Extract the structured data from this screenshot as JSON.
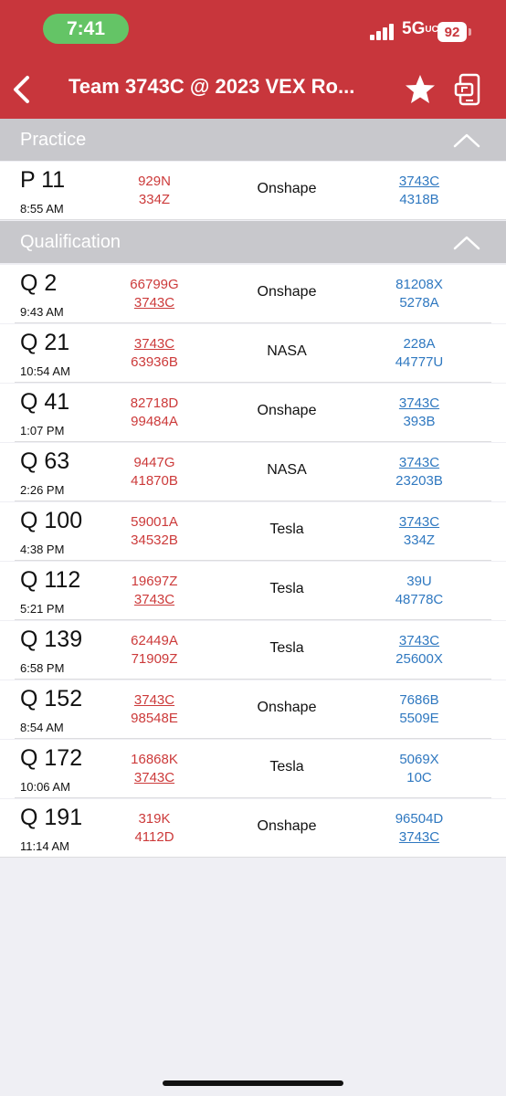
{
  "status": {
    "time": "7:41",
    "network": "5G",
    "network_suffix": "UC",
    "battery": "92"
  },
  "nav": {
    "title": "Team 3743C @ 2023 VEX Ro...",
    "icons": [
      "back-chevron-icon",
      "star-icon",
      "device-share-icon"
    ]
  },
  "colors": {
    "header_red": "#c8363c",
    "alliance_red": "#cc3a3a",
    "alliance_blue": "#2f78c0",
    "section_gray": "#c8c8cc",
    "time_pill_green": "#64c466"
  },
  "sections": [
    {
      "label": "Practice"
    },
    {
      "label": "Qualification"
    }
  ],
  "practice": [
    {
      "match": "P 11",
      "time": "8:55 AM",
      "red": [
        "929N",
        "334Z"
      ],
      "field": "Onshape",
      "blue": [
        "3743C",
        "4318B"
      ]
    }
  ],
  "qualification": [
    {
      "match": "Q 2",
      "time": "9:43 AM",
      "red": [
        "66799G",
        "3743C"
      ],
      "field": "Onshape",
      "blue": [
        "81208X",
        "5278A"
      ]
    },
    {
      "match": "Q 21",
      "time": "10:54 AM",
      "red": [
        "3743C",
        "63936B"
      ],
      "field": "NASA",
      "blue": [
        "228A",
        "44777U"
      ]
    },
    {
      "match": "Q 41",
      "time": "1:07 PM",
      "red": [
        "82718D",
        "99484A"
      ],
      "field": "Onshape",
      "blue": [
        "3743C",
        "393B"
      ]
    },
    {
      "match": "Q 63",
      "time": "2:26 PM",
      "red": [
        "9447G",
        "41870B"
      ],
      "field": "NASA",
      "blue": [
        "3743C",
        "23203B"
      ]
    },
    {
      "match": "Q 100",
      "time": "4:38 PM",
      "red": [
        "59001A",
        "34532B"
      ],
      "field": "Tesla",
      "blue": [
        "3743C",
        "334Z"
      ]
    },
    {
      "match": "Q 112",
      "time": "5:21 PM",
      "red": [
        "19697Z",
        "3743C"
      ],
      "field": "Tesla",
      "blue": [
        "39U",
        "48778C"
      ]
    },
    {
      "match": "Q 139",
      "time": "6:58 PM",
      "red": [
        "62449A",
        "71909Z"
      ],
      "field": "Tesla",
      "blue": [
        "3743C",
        "25600X"
      ]
    },
    {
      "match": "Q 152",
      "time": "8:54 AM",
      "red": [
        "3743C",
        "98548E"
      ],
      "field": "Onshape",
      "blue": [
        "7686B",
        "5509E"
      ]
    },
    {
      "match": "Q 172",
      "time": "10:06 AM",
      "red": [
        "16868K",
        "3743C"
      ],
      "field": "Tesla",
      "blue": [
        "5069X",
        "10C"
      ]
    },
    {
      "match": "Q 191",
      "time": "11:14 AM",
      "red": [
        "319K",
        "4112D"
      ],
      "field": "Onshape",
      "blue": [
        "96504D",
        "3743C"
      ]
    }
  ]
}
